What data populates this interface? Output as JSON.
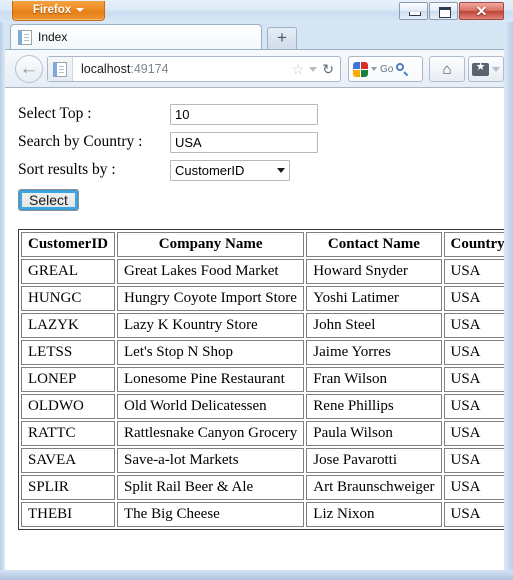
{
  "window": {
    "app_menu_label": "Firefox",
    "controls": {
      "minimize": "Minimize",
      "maximize": "Maximize",
      "close": "✕"
    }
  },
  "tabs": {
    "items": [
      {
        "title": "Index",
        "favicon": "document-icon"
      }
    ],
    "new_tab_label": "+"
  },
  "navbar": {
    "back_label": "←",
    "url_host": "localhost",
    "url_port": ":49174",
    "bookmark_icon": "star-icon",
    "reload_icon": "↻",
    "search_engine": "google-icon",
    "search_engine_text": "Go",
    "search_icon": "magnifier-icon",
    "home_icon": "⌂",
    "bookmarks_icon": "star-box-icon"
  },
  "form": {
    "fields": [
      {
        "label": "Select Top :",
        "type": "text",
        "value": "10",
        "name": "select-top"
      },
      {
        "label": "Search by Country :",
        "type": "text",
        "value": "USA",
        "name": "search-country"
      },
      {
        "label": "Sort results by :",
        "type": "select",
        "value": "CustomerID",
        "name": "sort-by"
      }
    ],
    "submit_label": "Select"
  },
  "table": {
    "headers": [
      "CustomerID",
      "Company Name",
      "Contact Name",
      "Country"
    ],
    "rows": [
      {
        "id": "GREAL",
        "company": "Great Lakes Food Market",
        "contact": "Howard Snyder",
        "country": "USA"
      },
      {
        "id": "HUNGC",
        "company": "Hungry Coyote Import Store",
        "contact": "Yoshi Latimer",
        "country": "USA"
      },
      {
        "id": "LAZYK",
        "company": "Lazy K Kountry Store",
        "contact": "John Steel",
        "country": "USA"
      },
      {
        "id": "LETSS",
        "company": "Let's Stop N Shop",
        "contact": "Jaime Yorres",
        "country": "USA"
      },
      {
        "id": "LONEP",
        "company": "Lonesome Pine Restaurant",
        "contact": "Fran Wilson",
        "country": "USA"
      },
      {
        "id": "OLDWO",
        "company": "Old World Delicatessen",
        "contact": "Rene Phillips",
        "country": "USA"
      },
      {
        "id": "RATTC",
        "company": "Rattlesnake Canyon Grocery",
        "contact": "Paula Wilson",
        "country": "USA"
      },
      {
        "id": "SAVEA",
        "company": "Save-a-lot Markets",
        "contact": "Jose Pavarotti",
        "country": "USA"
      },
      {
        "id": "SPLIR",
        "company": "Split Rail Beer & Ale",
        "contact": "Art Braunschweiger",
        "country": "USA"
      },
      {
        "id": "THEBI",
        "company": "The Big Cheese",
        "contact": "Liz Nixon",
        "country": "USA"
      }
    ]
  },
  "colors": {
    "firefox_orange": "#ef8b22",
    "close_red": "#bf4335",
    "focus_blue": "#2f9fdc",
    "frame_blue": "#cfe0f2"
  }
}
